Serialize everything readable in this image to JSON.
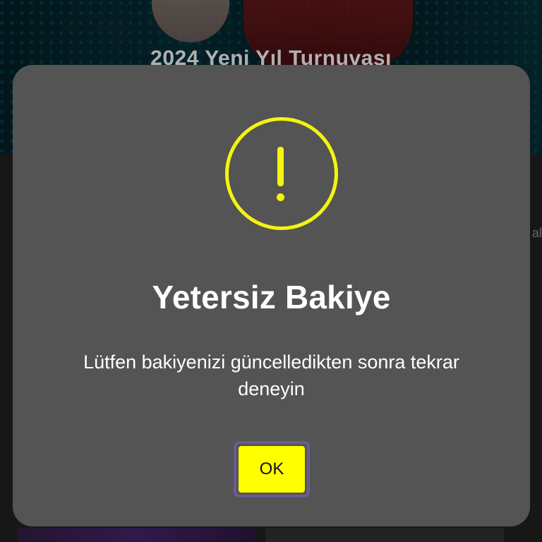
{
  "background": {
    "banner_title": "2024 Yeni Yıl Turnuvası",
    "side_text": "al"
  },
  "dialog": {
    "icon": "exclamation-circle-icon",
    "title": "Yetersiz Bakiye",
    "message": "Lütfen bakiyenizi güncelledikten sonra tekrar deneyin",
    "ok_label": "OK"
  },
  "colors": {
    "accent": "#f4f40f",
    "button_fill": "#ffff00",
    "button_focus_border": "#6a5c96",
    "dialog_bg": "#545454"
  }
}
